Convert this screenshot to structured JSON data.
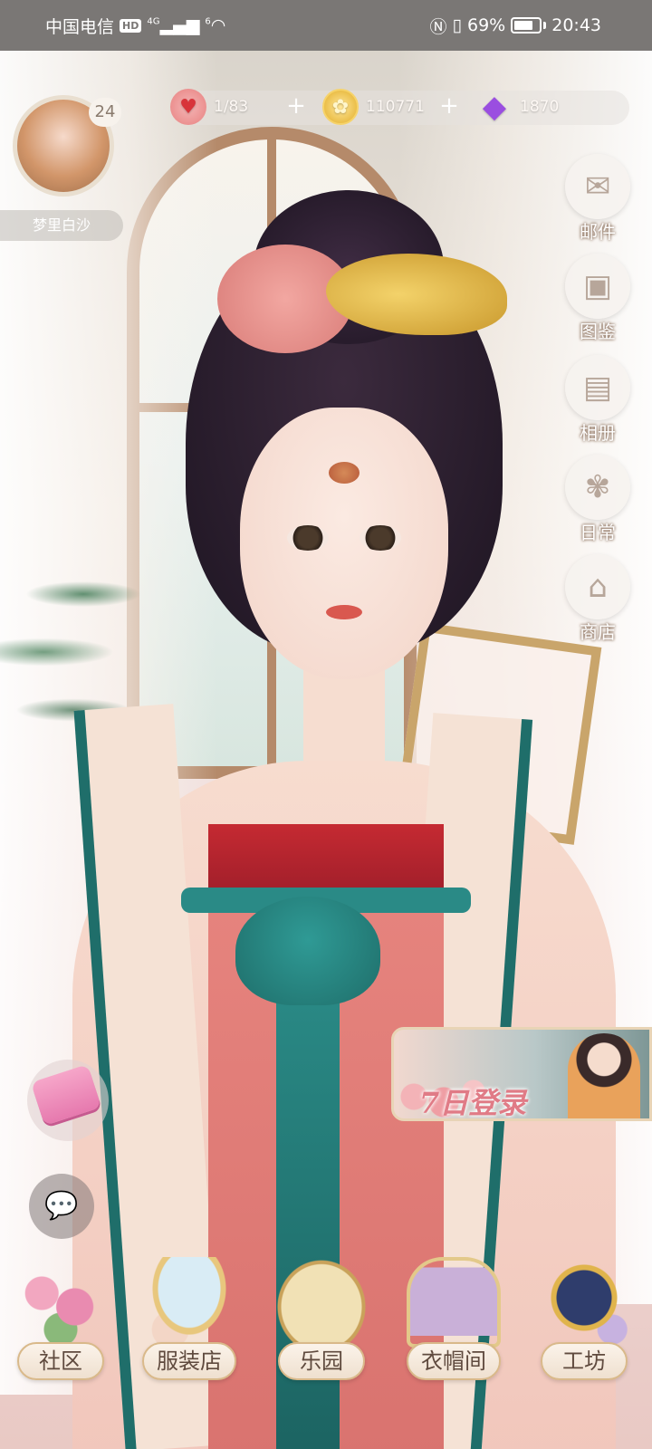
{
  "status_bar": {
    "carrier": "中国电信",
    "hd_badge": "HD",
    "network": "4G",
    "wifi_sup": "6",
    "battery_percent": "69%",
    "time": "20:43"
  },
  "resources": {
    "stamina": "1/83",
    "coins": "110771",
    "gems": "1870",
    "stamina_icon": "heart-icon",
    "coin_icon": "coin-icon",
    "gem_icon": "diamond-icon",
    "plus_symbol": "+"
  },
  "player": {
    "level": "24",
    "name": "梦里白沙"
  },
  "side_menu": [
    {
      "label": "邮件",
      "icon": "envelope-icon"
    },
    {
      "label": "图鉴",
      "icon": "catalog-icon"
    },
    {
      "label": "相册",
      "icon": "album-icon"
    },
    {
      "label": "日常",
      "icon": "daily-icon"
    },
    {
      "label": "商店",
      "icon": "store-icon"
    }
  ],
  "event_banner": {
    "title": "7日登录"
  },
  "bottom_nav": [
    {
      "label": "社区",
      "icon": "community-icon"
    },
    {
      "label": "服装店",
      "icon": "clothing-shop-icon"
    },
    {
      "label": "乐园",
      "icon": "park-icon"
    },
    {
      "label": "衣帽间",
      "icon": "wardrobe-icon"
    },
    {
      "label": "工坊",
      "icon": "workshop-icon"
    }
  ],
  "colors": {
    "accent_pink": "#e07b86",
    "teal": "#1f6e6a",
    "gold": "#d9b98a",
    "status_bar_bg": "#7a7775"
  }
}
